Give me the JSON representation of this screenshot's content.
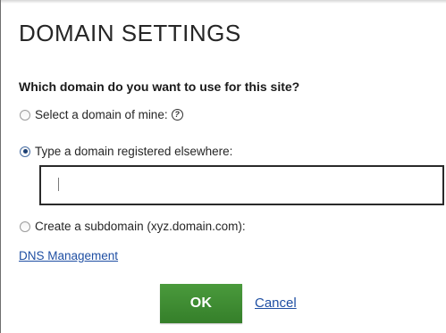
{
  "dialog": {
    "title": "DOMAIN SETTINGS",
    "question": "Which domain do you want to use for this site?"
  },
  "options": [
    {
      "label": "Select a domain of mine:",
      "checked": false,
      "help_icon": "question-circle-icon"
    },
    {
      "label": "Type a domain registered elsewhere:",
      "checked": true
    },
    {
      "label": "Create a subdomain (xyz.domain.com):",
      "checked": false
    }
  ],
  "domain_input": {
    "value": "",
    "placeholder": ""
  },
  "links": {
    "dns_management": "DNS Management",
    "cancel": "Cancel"
  },
  "buttons": {
    "ok": "OK"
  },
  "colors": {
    "ok_button": "#3f8c33",
    "link": "#1f4fa3",
    "radio_checked": "#1c3f73"
  }
}
